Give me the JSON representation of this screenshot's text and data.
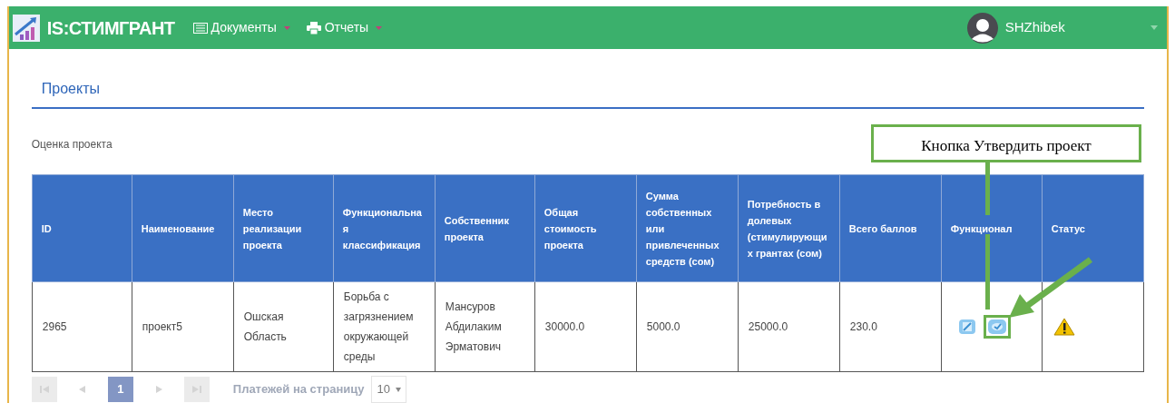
{
  "navbar": {
    "brand": "IS:СТИМГРАНТ",
    "menu": [
      {
        "label": "Документы",
        "kind": "list"
      },
      {
        "label": "Отчеты",
        "kind": "print"
      }
    ],
    "user": "SHZhibek"
  },
  "page_title": "Проекты",
  "section_label": "Оценка проекта",
  "table": {
    "columns": [
      "ID",
      "Наименование",
      "Место реализации проекта",
      "Функциональная классификация",
      "Собственник проекта",
      "Общая стоимость проекта",
      "Сумма собственных или привлеченных средств (сом)",
      "Потребность в долевых (стимулирующих грантах (сом)",
      "Всего баллов",
      "Функционал",
      "Статус"
    ],
    "rows": [
      {
        "cells": [
          "2965",
          "проект5",
          "Ошская Область",
          "Борьба с загрязнением окружающей среды",
          "Мансуров Абдилаким Эрматович",
          "30000.0",
          "5000.0",
          "25000.0",
          "230.0"
        ],
        "actions": [
          {
            "kind": "edit",
            "highlighted": false
          },
          {
            "kind": "approve",
            "highlighted": true
          }
        ],
        "status": {
          "kind": "warning"
        }
      }
    ]
  },
  "pagination": {
    "pages": [
      {
        "label": "1",
        "selected": true
      }
    ],
    "per_page_label": "Платежей на страницу",
    "per_page": "10"
  },
  "annotation": {
    "text": "Кнопка Утвердить проект"
  }
}
